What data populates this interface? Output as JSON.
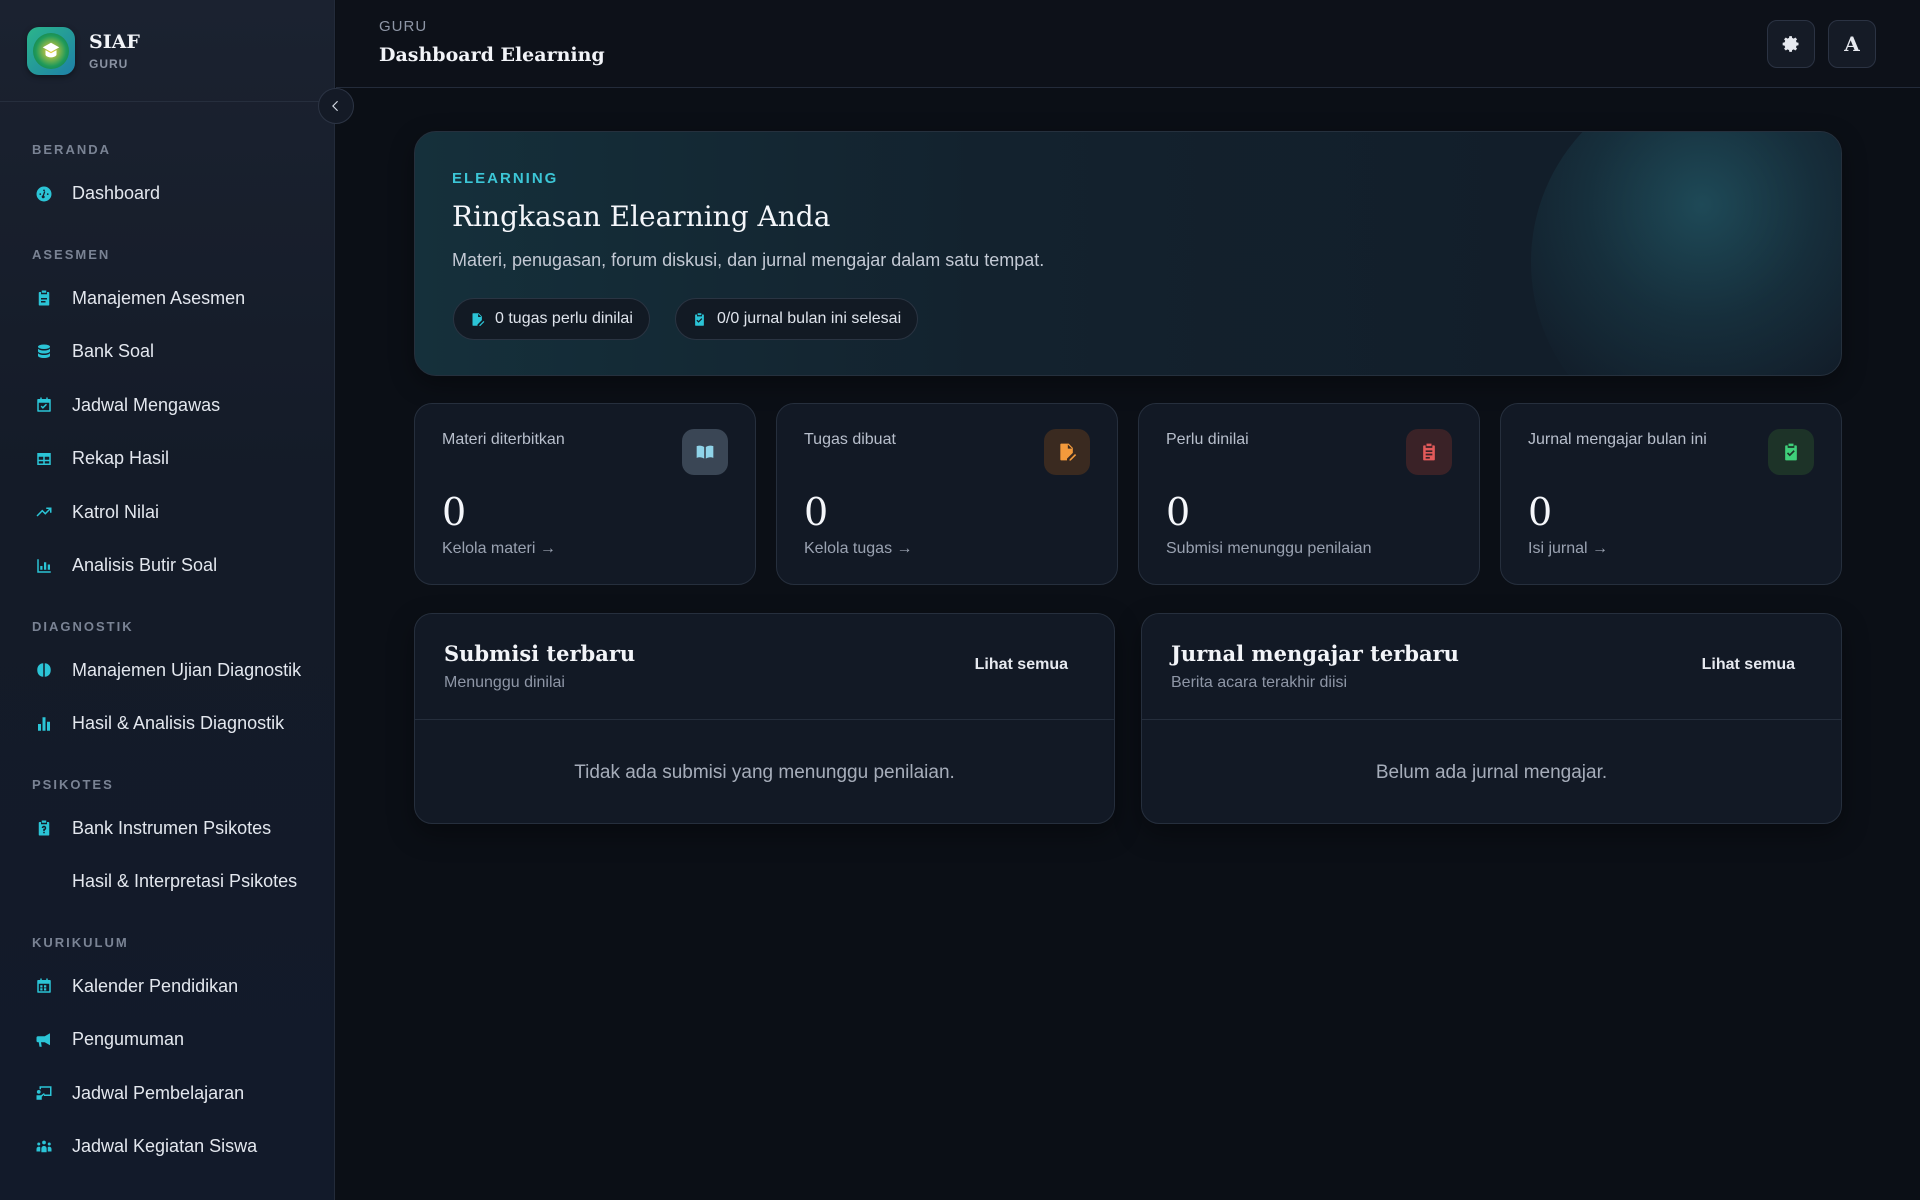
{
  "brand": {
    "title": "SIAF",
    "subtitle": "GURU"
  },
  "sidebar": {
    "sections": [
      {
        "label": "BERANDA",
        "items": [
          {
            "label": "Dashboard",
            "icon": "gauge-icon"
          }
        ]
      },
      {
        "label": "ASESMEN",
        "items": [
          {
            "label": "Manajemen Asesmen",
            "icon": "clipboard-icon"
          },
          {
            "label": "Bank Soal",
            "icon": "database-icon"
          },
          {
            "label": "Jadwal Mengawas",
            "icon": "calendar-check-icon"
          },
          {
            "label": "Rekap Hasil",
            "icon": "table-icon"
          },
          {
            "label": "Katrol Nilai",
            "icon": "trend-up-icon"
          },
          {
            "label": "Analisis Butir Soal",
            "icon": "bar-chart-icon"
          }
        ]
      },
      {
        "label": "DIAGNOSTIK",
        "items": [
          {
            "label": "Manajemen Ujian Diagnostik",
            "icon": "brain-icon"
          },
          {
            "label": "Hasil & Analisis Diagnostik",
            "icon": "chart-column-icon"
          }
        ]
      },
      {
        "label": "PSIKOTES",
        "items": [
          {
            "label": "Bank Instrumen Psikotes",
            "icon": "clipboard-question-icon"
          },
          {
            "label": "Hasil & Interpretasi Psikotes",
            "icon": ""
          }
        ]
      },
      {
        "label": "KURIKULUM",
        "items": [
          {
            "label": "Kalender Pendidikan",
            "icon": "calendar-icon"
          },
          {
            "label": "Pengumuman",
            "icon": "megaphone-icon"
          },
          {
            "label": "Jadwal Pembelajaran",
            "icon": "teacher-board-icon"
          },
          {
            "label": "Jadwal Kegiatan Siswa",
            "icon": "people-group-icon"
          }
        ]
      }
    ]
  },
  "header": {
    "breadcrumb": "GURU",
    "title": "Dashboard Elearning"
  },
  "hero": {
    "kicker": "ELEARNING",
    "title": "Ringkasan Elearning Anda",
    "subtitle": "Materi, penugasan, forum diskusi, dan jurnal mengajar dalam satu tempat.",
    "pill_tasks": "0 tugas perlu dinilai",
    "pill_journal": "0/0 jurnal bulan ini selesai"
  },
  "stats": [
    {
      "label": "Materi diterbitkan",
      "value": "0",
      "link": "Kelola materi →",
      "icon": "book-icon",
      "color": "#8fd3e8"
    },
    {
      "label": "Tugas dibuat",
      "value": "0",
      "link": "Kelola tugas →",
      "icon": "file-pen-icon",
      "color": "#f39a3c"
    },
    {
      "label": "Perlu dinilai",
      "value": "0",
      "link": "Submisi menunggu penilaian",
      "icon": "clipboard-list-icon",
      "color": "#e25a5a"
    },
    {
      "label": "Jurnal mengajar bulan ini",
      "value": "0",
      "link": "Isi jurnal →",
      "icon": "clipboard-check-icon",
      "color": "#3fcf7a"
    }
  ],
  "panels": {
    "submissions": {
      "title": "Submisi terbaru",
      "subtitle": "Menunggu dinilai",
      "link": "Lihat semua",
      "empty": "Tidak ada submisi yang menunggu penilaian."
    },
    "journals": {
      "title": "Jurnal mengajar terbaru",
      "subtitle": "Berita acara terakhir diisi",
      "link": "Lihat semua",
      "empty": "Belum ada jurnal mengajar."
    }
  },
  "header_buttons": {
    "font_label": "A"
  }
}
